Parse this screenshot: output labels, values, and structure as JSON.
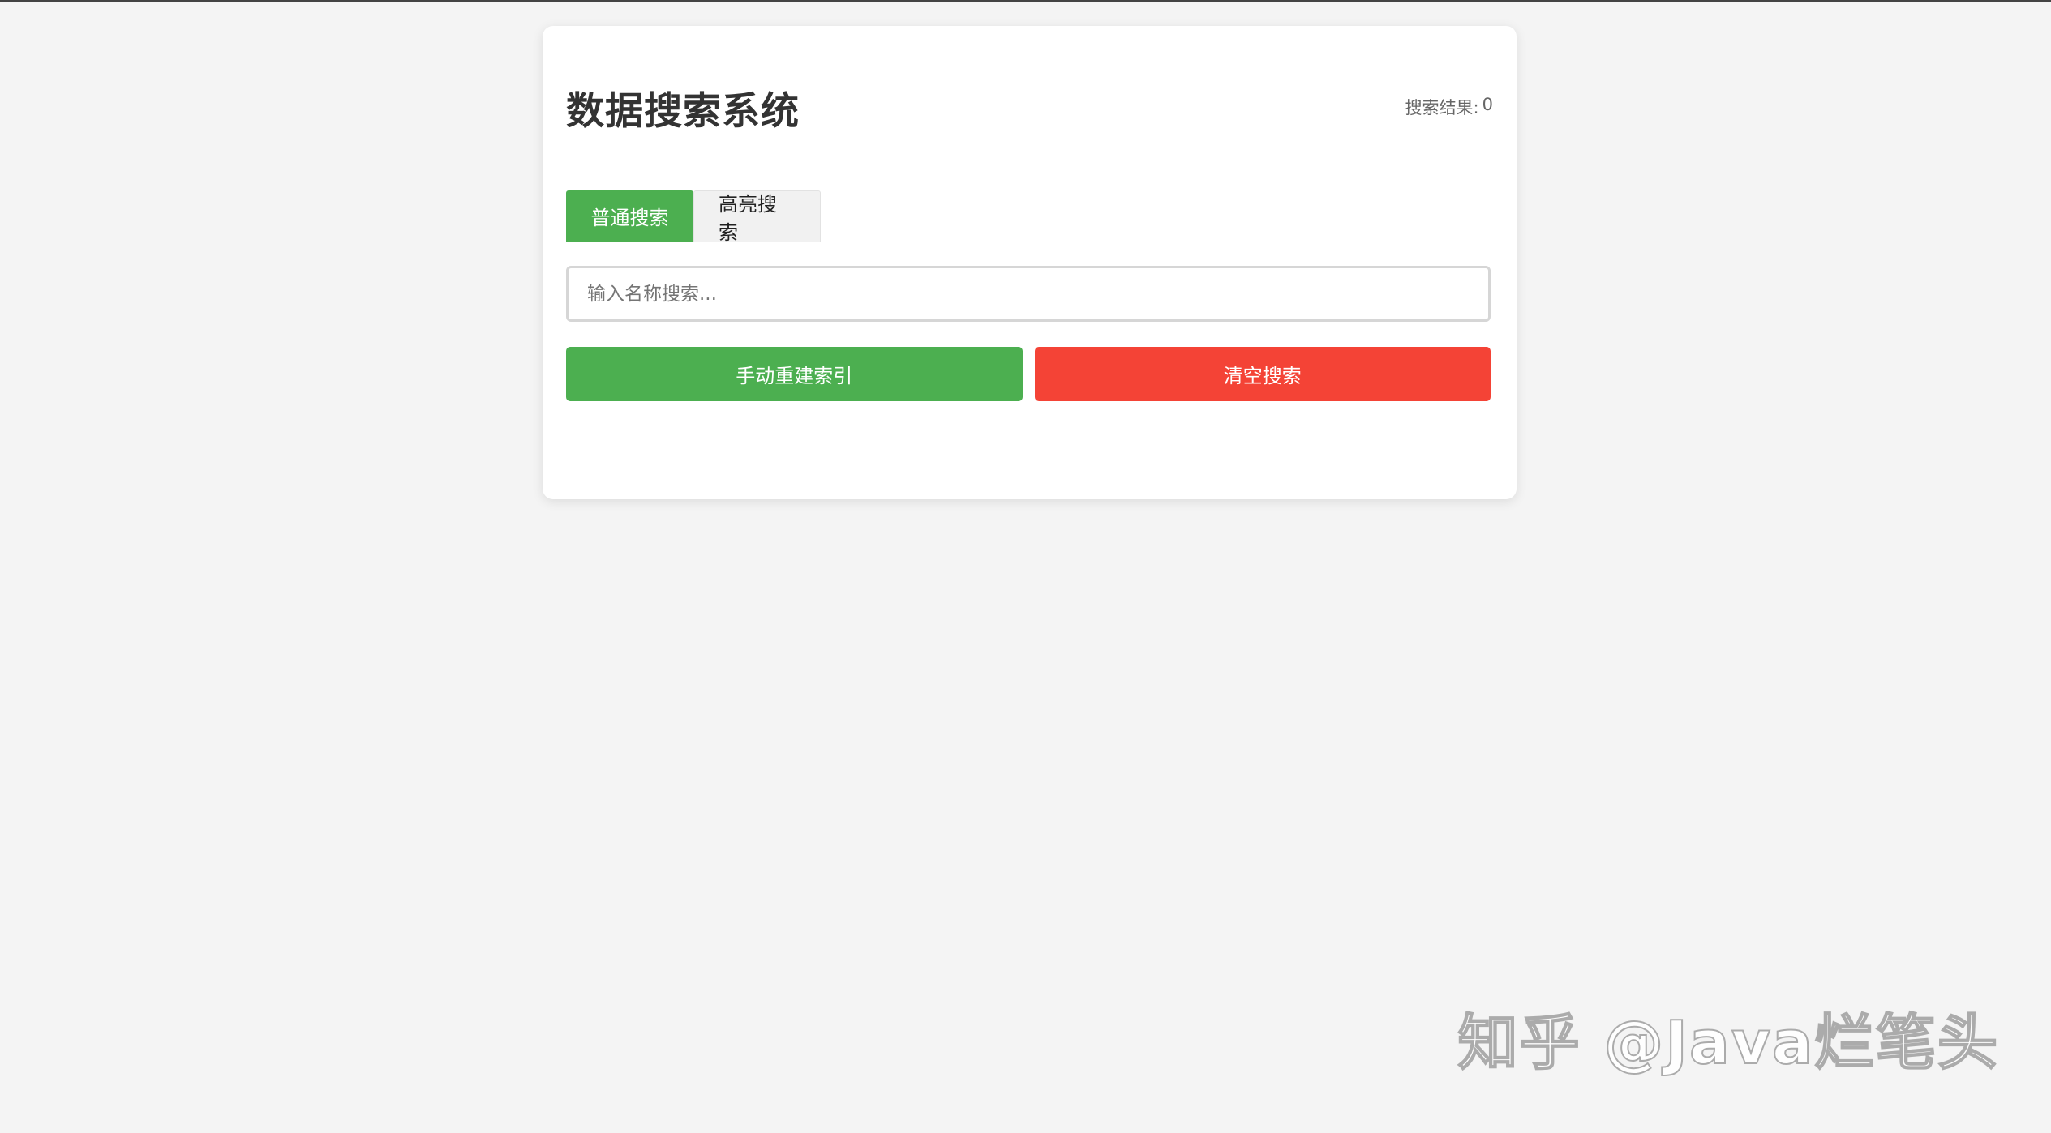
{
  "header": {
    "title": "数据搜索系统",
    "result_label": "搜索结果:",
    "result_count": "0"
  },
  "tabs": [
    {
      "label": "普通搜索",
      "active": true
    },
    {
      "label": "高亮搜索",
      "active": false
    }
  ],
  "search": {
    "placeholder": "输入名称搜索...",
    "value": ""
  },
  "actions": {
    "rebuild_label": "手动重建索引",
    "clear_label": "清空搜索"
  },
  "watermark": "知乎 @Java烂笔头",
  "colors": {
    "primary_green": "#4caf50",
    "danger_red": "#f44336",
    "background": "#f4f4f4"
  }
}
